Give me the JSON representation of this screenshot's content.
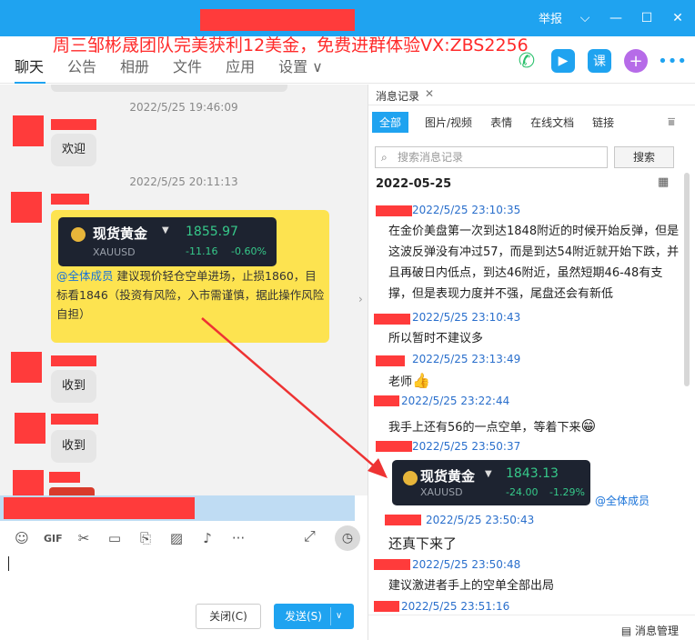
{
  "title_bar": {
    "report_label": "举报",
    "icons": [
      "chevron-down-icon",
      "minimize-icon",
      "maximize-icon",
      "close-icon"
    ]
  },
  "promo_text": "周三邹彬晟团队完美获利12美金，免费进群体验VX:ZBS2256",
  "tabs": [
    {
      "label": "聊天",
      "active": true
    },
    {
      "label": "公告"
    },
    {
      "label": "相册"
    },
    {
      "label": "文件"
    },
    {
      "label": "应用"
    },
    {
      "label": "设置 ∨"
    }
  ],
  "top_actions": [
    "phone-icon",
    "video-icon",
    "class-icon",
    "plus-icon",
    "more-icon"
  ],
  "top_actions_labels": {
    "class": "课"
  },
  "chat": {
    "timestamps": [
      "2022/5/25 19:46:09",
      "2022/5/25 20:11:13"
    ],
    "messages": [
      {
        "text": "欢迎"
      },
      {
        "card": {
          "name": "现货黄金",
          "symbol": "XAUUSD",
          "price": "1855.97",
          "change": "-11.16",
          "change_pct": "-0.60%"
        },
        "mention": "@全体成员",
        "text": "建议现价轻仓空单进场，止损1860，目标看1846（投资有风险，入市需谨慎，据此操作风险自担）"
      },
      {
        "text": "收到"
      },
      {
        "text": "收到"
      }
    ]
  },
  "colors": {
    "accent": "#1fa3f0",
    "redaction": "#ff3b3b",
    "card_bg": "#1d2330",
    "card_green": "#36c98a",
    "highlight": "#fde350"
  },
  "buttons": {
    "close": "关闭(C)",
    "send": "发送(S)"
  },
  "history": {
    "title": "消息记录",
    "tabs": [
      "全部",
      "图片/视频",
      "表情",
      "在线文档",
      "链接"
    ],
    "search_placeholder": "搜索消息记录",
    "search_button": "搜索",
    "date": "2022-05-25",
    "entries": [
      {
        "time": "2022/5/25 23:10:35",
        "text": "在金价美盘第一次到达1848附近的时候开始反弹，但是这波反弹没有冲过57，而是到达54附近就开始下跌，并且再破日内低点，到达46附近，虽然短期46-48有支撑，但是表现力度并不强，尾盘还会有新低"
      },
      {
        "time": "2022/5/25 23:10:43",
        "text": "所以暂时不建议多"
      },
      {
        "time": "2022/5/25 23:13:49",
        "text": "老师"
      },
      {
        "time": "2022/5/25 23:22:44",
        "text": "我手上还有56的一点空单，等着下来"
      },
      {
        "time": "2022/5/25 23:50:37",
        "card": {
          "name": "现货黄金",
          "symbol": "XAUUSD",
          "price": "1843.13",
          "change": "-24.00",
          "change_pct": "-1.29%"
        },
        "mention": "@全体成员"
      },
      {
        "time": "2022/5/25 23:50:43",
        "text": "还真下来了"
      },
      {
        "time": "2022/5/25 23:50:48",
        "text": "建议激进者手上的空单全部出局"
      },
      {
        "time": "2022/5/25 23:51:16"
      }
    ],
    "footer": "消息管理"
  }
}
